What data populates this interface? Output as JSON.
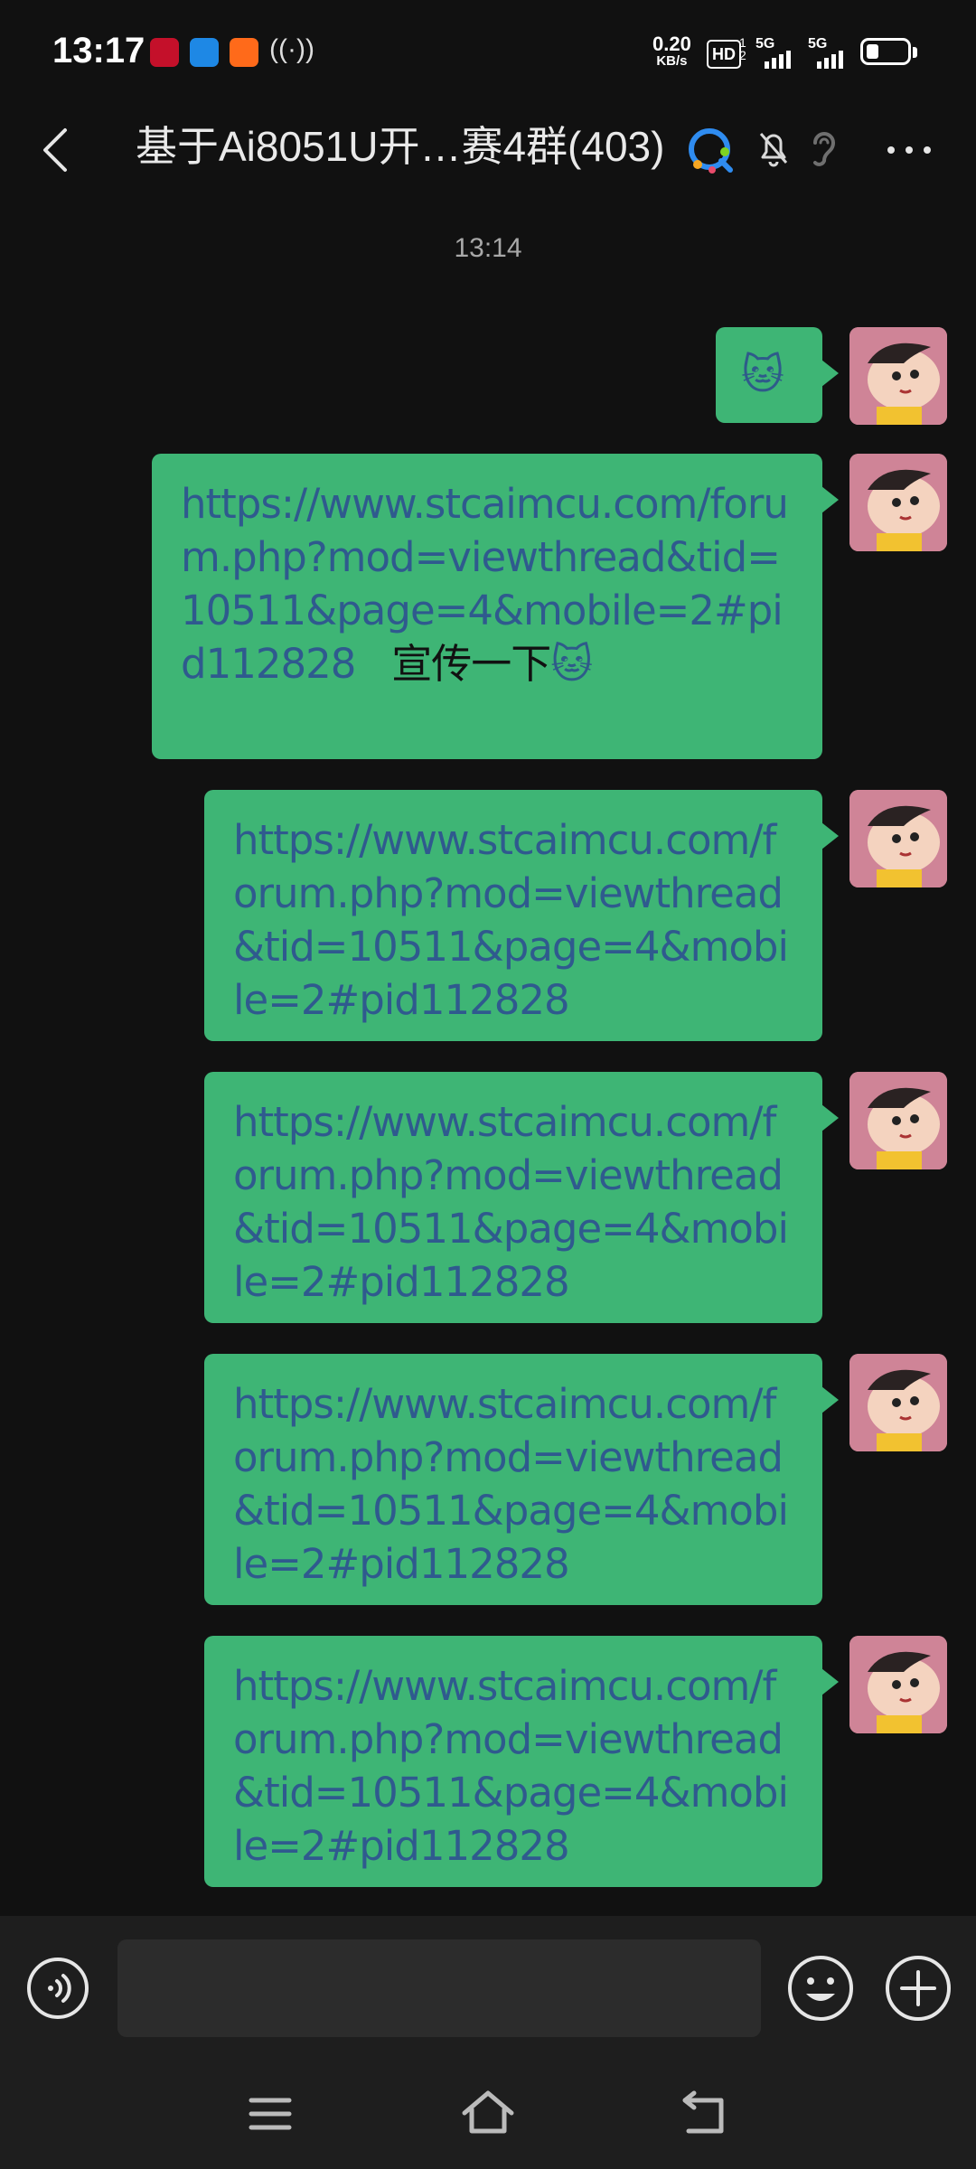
{
  "status_bar": {
    "time": "13:17",
    "hotspot_icon": "hotspot-icon",
    "net_speed": "0.20",
    "net_speed_unit": "KB/s",
    "hd_label": "HD",
    "hd_sub": "1 2",
    "sim1_label": "5G",
    "sim2_label": "5G",
    "battery_level": 0.3
  },
  "header": {
    "title": "基于Ai8051U开…赛4群(403)"
  },
  "timestamp": "13:14",
  "messages": [
    {
      "emoji": "🐱",
      "text": ""
    },
    {
      "url": "https://www.stcaimcu.com/forum.php?mod=viewthread&tid=10511&page=4&mobile=2#pid112828",
      "suffix": "宣传一下",
      "emoji": "🐱"
    },
    {
      "url": "https://www.stcaimcu.com/forum.php?mod=viewthread&tid=10511&page=4&mobile=2#pid112828"
    },
    {
      "url": "https://www.stcaimcu.com/forum.php?mod=viewthread&tid=10511&page=4&mobile=2#pid112828"
    },
    {
      "url": "https://www.stcaimcu.com/forum.php?mod=viewthread&tid=10511&page=4&mobile=2#pid112828"
    },
    {
      "url": "https://www.stcaimcu.com/forum.php?mod=viewthread&tid=10511&page=4&mobile=2#pid112828"
    }
  ],
  "input": {
    "value": ""
  },
  "colors": {
    "bubble": "#3eb575",
    "link": "#2f5a8e",
    "background": "#111111"
  }
}
